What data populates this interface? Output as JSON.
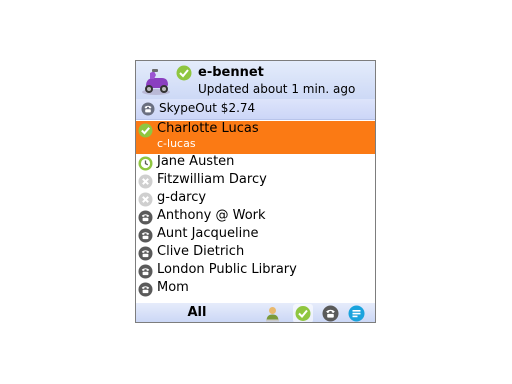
{
  "header": {
    "username": "e-bennet",
    "status_text": "Updated about 1 min. ago",
    "avatar": "scooter-avatar",
    "presence_icon": "online-check-icon"
  },
  "skypeout": {
    "label": "SkypeOut $2.74",
    "icon": "skypeout-phone-icon"
  },
  "contacts": [
    {
      "name": "Charlotte Lucas",
      "sub": "c-lucas",
      "status": "online",
      "selected": true
    },
    {
      "name": "Jane Austen",
      "status": "away"
    },
    {
      "name": "Fitzwilliam Darcy",
      "status": "offline"
    },
    {
      "name": "g-darcy",
      "status": "offline"
    },
    {
      "name": "Anthony @ Work",
      "status": "phone"
    },
    {
      "name": "Aunt Jacqueline",
      "status": "phone"
    },
    {
      "name": "Clive Dietrich",
      "status": "phone"
    },
    {
      "name": "London Public Library",
      "status": "phone"
    },
    {
      "name": "Mom",
      "status": "phone"
    }
  ],
  "bottom": {
    "active_tab": "All",
    "icons": [
      "contacts-person-icon",
      "online-filter-icon",
      "phone-filter-icon",
      "chat-filter-icon"
    ]
  },
  "colors": {
    "selected_row": "#fb7a14",
    "header_bg": "#cdd9f6",
    "online_green": "#8fc640",
    "phone_gray": "#5a5a5a"
  }
}
